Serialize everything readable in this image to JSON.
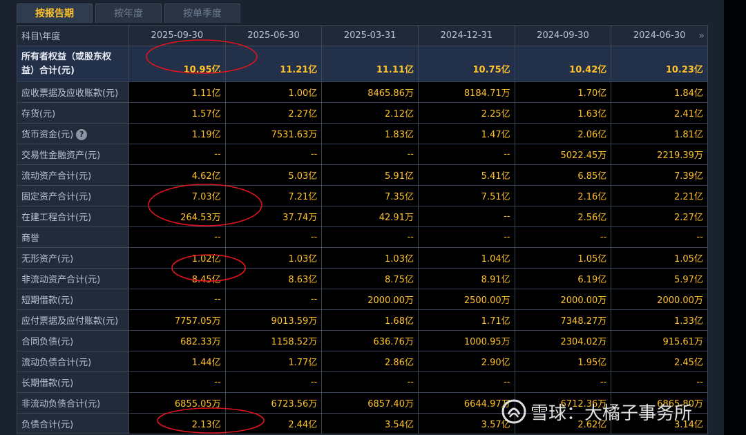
{
  "tabs": [
    {
      "label": "按报告期"
    },
    {
      "label": "按年度"
    },
    {
      "label": "按单季度"
    }
  ],
  "header": {
    "label": "科目\\年度",
    "dates": [
      "2025-09-30",
      "2025-06-30",
      "2025-03-31",
      "2024-12-31",
      "2024-09-30",
      "2024-06-30"
    ],
    "more_icon": "»"
  },
  "equity": {
    "label": "所有者权益（或股东权益）合计(元)",
    "values": [
      "10.95亿",
      "11.21亿",
      "11.11亿",
      "10.75亿",
      "10.42亿",
      "10.23亿"
    ]
  },
  "rows": [
    {
      "label": "应收票据及应收账款(元)",
      "values": [
        "1.11亿",
        "1.00亿",
        "8465.86万",
        "8184.71万",
        "1.70亿",
        "1.84亿"
      ]
    },
    {
      "label": "存货(元)",
      "values": [
        "1.57亿",
        "2.27亿",
        "2.12亿",
        "2.25亿",
        "1.63亿",
        "2.41亿"
      ]
    },
    {
      "label": "货币资金(元)",
      "values": [
        "1.19亿",
        "7531.63万",
        "1.83亿",
        "1.47亿",
        "2.06亿",
        "1.81亿"
      ]
    },
    {
      "label": "交易性金融资产(元)",
      "values": [
        "--",
        "--",
        "--",
        "--",
        "5022.45万",
        "2219.39万"
      ]
    },
    {
      "label": "流动资产合计(元)",
      "values": [
        "4.62亿",
        "5.03亿",
        "5.91亿",
        "5.41亿",
        "6.85亿",
        "7.39亿"
      ]
    },
    {
      "label": "固定资产合计(元)",
      "values": [
        "7.03亿",
        "7.21亿",
        "7.35亿",
        "7.51亿",
        "2.16亿",
        "2.21亿"
      ]
    },
    {
      "label": "在建工程合计(元)",
      "values": [
        "264.53万",
        "37.74万",
        "42.91万",
        "--",
        "2.56亿",
        "2.27亿"
      ]
    },
    {
      "label": "商誉",
      "values": [
        "--",
        "--",
        "--",
        "--",
        "--",
        "--"
      ]
    },
    {
      "label": "无形资产(元)",
      "values": [
        "1.02亿",
        "1.03亿",
        "1.03亿",
        "1.04亿",
        "1.05亿",
        "1.05亿"
      ]
    },
    {
      "label": "非流动资产合计(元)",
      "values": [
        "8.45亿",
        "8.63亿",
        "8.75亿",
        "8.91亿",
        "6.19亿",
        "5.97亿"
      ]
    },
    {
      "label": "短期借款(元)",
      "values": [
        "--",
        "--",
        "2000.00万",
        "2500.00万",
        "2000.00万",
        "2000.00万"
      ]
    },
    {
      "label": "应付票据及应付账款(元)",
      "values": [
        "7757.05万",
        "9013.59万",
        "1.68亿",
        "1.71亿",
        "7348.27万",
        "1.33亿"
      ]
    },
    {
      "label": "合同负债(元)",
      "values": [
        "682.33万",
        "1158.52万",
        "636.76万",
        "1000.95万",
        "2304.02万",
        "915.61万"
      ]
    },
    {
      "label": "流动负债合计(元)",
      "values": [
        "1.44亿",
        "1.77亿",
        "2.86亿",
        "2.90亿",
        "1.95亿",
        "2.45亿"
      ]
    },
    {
      "label": "长期借款(元)",
      "values": [
        "--",
        "--",
        "--",
        "--",
        "--",
        "--"
      ]
    },
    {
      "label": "非流动负债合计(元)",
      "values": [
        "6855.05万",
        "6723.56万",
        "6857.40万",
        "6644.97万",
        "6712.36万",
        "6865.80万"
      ]
    },
    {
      "label": "负债合计(元)",
      "values": [
        "2.13亿",
        "2.44亿",
        "3.54亿",
        "3.57亿",
        "2.62亿",
        "3.14亿"
      ]
    }
  ],
  "help_icon": "?",
  "watermark": {
    "text": "雪球：大橘子事务所"
  },
  "colors": {
    "value": "#ffc22b",
    "annotation": "#e0141e"
  }
}
